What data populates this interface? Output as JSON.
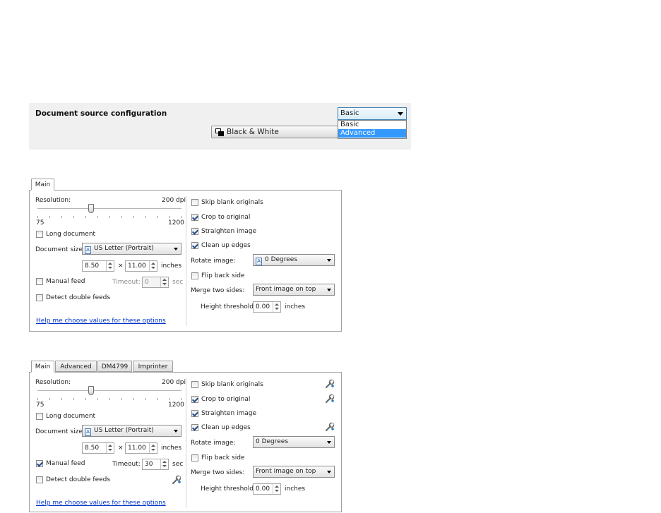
{
  "config": {
    "title": "Document source configuration",
    "color_mode": "Black & White",
    "mode_selected": "Basic",
    "mode_options": [
      "Basic",
      "Advanced"
    ],
    "highlight_color": "#3399ff"
  },
  "basic_panel": {
    "tabs": [
      "Main"
    ],
    "resolution_label": "Resolution:",
    "resolution_value": "200 dpi",
    "resolution_min": "75",
    "resolution_max": "1200",
    "long_document": "Long document",
    "document_size_label": "Document size:",
    "document_size": "US Letter (Portrait)",
    "width": "8.50",
    "times": "×",
    "height": "11.00",
    "units": "inches",
    "manual_feed": "Manual feed",
    "timeout_label": "Timeout:",
    "timeout_value": "0",
    "timeout_units": "sec",
    "detect_double": "Detect double feeds",
    "help_link": "Help me choose values for these options",
    "skip_blank": "Skip blank originals",
    "crop": "Crop to original",
    "straighten": "Straighten image",
    "clean_edges": "Clean up edges",
    "rotate_label": "Rotate image:",
    "rotate_value": "0 Degrees",
    "flip": "Flip back side",
    "merge_label": "Merge two sides:",
    "merge_value": "Front image on top",
    "height_threshold_label": "Height threshold:",
    "height_threshold": "0.00",
    "height_threshold_units": "inches",
    "checked": {
      "long_document": false,
      "manual_feed": false,
      "detect_double": false,
      "skip_blank": false,
      "crop": true,
      "straighten": true,
      "clean_edges": true,
      "flip": false
    }
  },
  "advanced_panel": {
    "tabs": [
      "Main",
      "Advanced",
      "DM4799",
      "Imprinter"
    ],
    "resolution_label": "Resolution:",
    "resolution_value": "200 dpi",
    "resolution_min": "75",
    "resolution_max": "1200",
    "long_document": "Long document",
    "document_size_label": "Document size:",
    "document_size": "US Letter (Portrait)",
    "width": "8.50",
    "times": "×",
    "height": "11.00",
    "units": "inches",
    "manual_feed": "Manual feed",
    "timeout_label": "Timeout:",
    "timeout_value": "30",
    "timeout_units": "sec",
    "detect_double": "Detect double feeds",
    "help_link": "Help me choose values for these options",
    "skip_blank": "Skip blank originals",
    "crop": "Crop to original",
    "straighten": "Straighten image",
    "clean_edges": "Clean up edges",
    "rotate_label": "Rotate image:",
    "rotate_value": "0 Degrees",
    "flip": "Flip back side",
    "merge_label": "Merge two sides:",
    "merge_value": "Front image on top",
    "height_threshold_label": "Height threshold:",
    "height_threshold": "0.00",
    "height_threshold_units": "inches",
    "checked": {
      "long_document": false,
      "manual_feed": true,
      "detect_double": false,
      "skip_blank": false,
      "crop": true,
      "straighten": true,
      "clean_edges": true,
      "flip": false
    }
  }
}
